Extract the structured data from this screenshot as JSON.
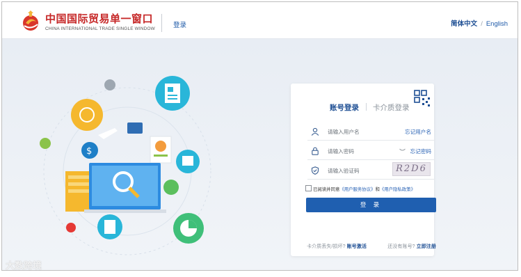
{
  "header": {
    "logo_title": "中国国际贸易单一窗口",
    "logo_subtitle": "CHINA INTERNATIONAL TRADE SINGLE WINDOW",
    "login_link": "登录",
    "lang_zh": "简体中文",
    "lang_sep": "/",
    "lang_en": "English"
  },
  "login": {
    "tab_account": "账号登录",
    "tab_card": "卡介质登录",
    "username_placeholder": "请输入用户名",
    "forgot_username": "忘记用户名",
    "password_placeholder": "请输入密码",
    "forgot_password": "忘记密码",
    "captcha_placeholder": "请输入验证码",
    "captcha_text": "R2D6",
    "agree_prefix": "已阅读并同意",
    "agree_service": "《用户服务协议》",
    "agree_and": "和",
    "agree_privacy": "《用户隐私政策》",
    "submit": "登 录",
    "card_lost": "卡介质丢失/损坏?",
    "card_activate": "账号激活",
    "no_account": "还没有账号?",
    "register": "立即注册"
  },
  "watermark": "大数跨境",
  "colors": {
    "brand_red": "#c62828",
    "primary_blue": "#1f5fb0",
    "link_blue": "#2a63b5"
  },
  "icons": [
    "logo-emblem",
    "user-icon",
    "lock-icon",
    "shield-icon",
    "qr-code-icon",
    "eye-icon"
  ]
}
